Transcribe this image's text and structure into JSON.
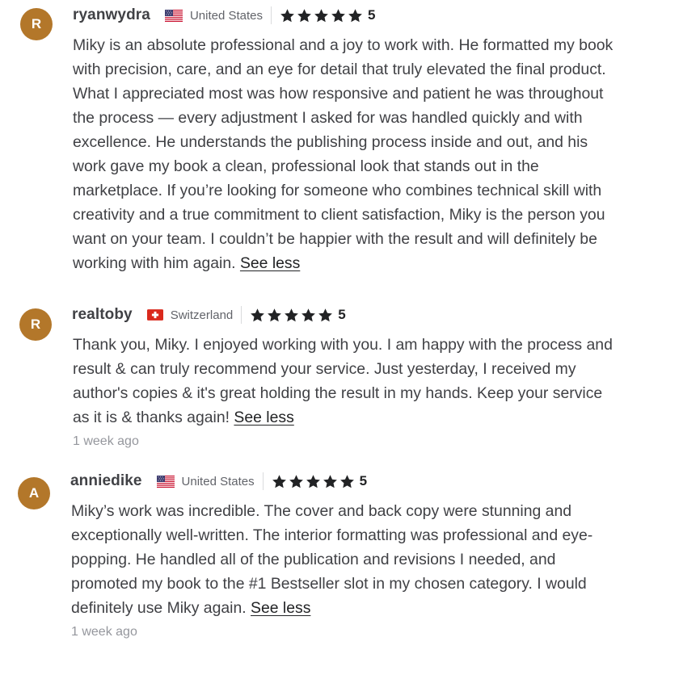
{
  "reviews": [
    {
      "avatar_letter": "R",
      "username": "ryanwydra",
      "flag_icon": "us-flag-icon",
      "country": "United States",
      "rating": "5",
      "body": "Miky is an absolute professional and a joy to work with. He formatted my book\nwith precision, care, and an eye for detail that truly elevated the final product.\nWhat I appreciated most was how responsive and patient he was throughout\nthe process — every adjustment I asked for was handled quickly and with\nexcellence. He understands the publishing process inside and out, and his\nwork gave my book a clean, professional look that stands out in the\nmarketplace. If you’re looking for someone who combines technical skill with\ncreativity and a true commitment to client satisfaction, Miky is the person you\nwant on your team. I couldn’t be happier with the result and will definitely be\nworking with him again. ",
      "see_less": "See less",
      "time": ""
    },
    {
      "avatar_letter": "R",
      "username": "realtoby",
      "flag_icon": "swiss-flag-icon",
      "country": "Switzerland",
      "rating": "5",
      "body": "Thank you, Miky. I enjoyed working with you. I am happy with the process and\nresult & can truly recommend your service. Just yesterday, I received my\nauthor's copies & it's great holding the result in my hands. Keep your service\nas it is & thanks again! ",
      "see_less": "See less",
      "time": "1 week ago"
    },
    {
      "avatar_letter": "A",
      "username": "anniedike",
      "flag_icon": "us-flag-icon",
      "country": "United States",
      "rating": "5",
      "body": "Miky’s work was incredible. The cover and back copy were stunning and\nexceptionally well-written. The interior formatting was professional and eye-\npopping. He handled all of the publication and revisions I needed, and\npromoted my book to the #1 Bestseller slot in my chosen category. I would\ndefinitely use Miky again. ",
      "see_less": "See less",
      "time": "1 week ago"
    }
  ],
  "colors": {
    "avatar_bg": "#b3772a",
    "text": "#404145",
    "muted": "#95979d",
    "star": "#222325"
  }
}
